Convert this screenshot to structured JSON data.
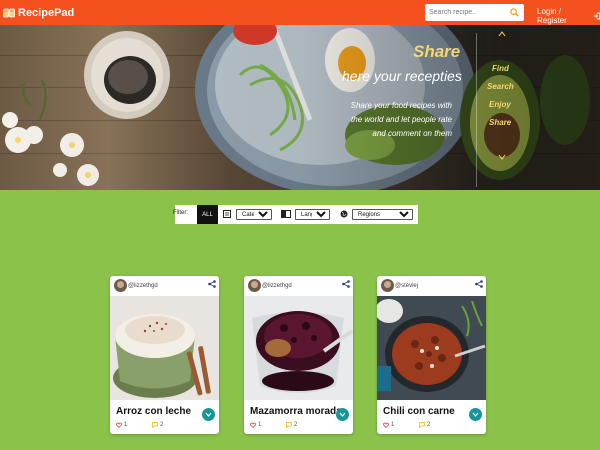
{
  "navbar": {
    "brand": "RecipePad",
    "search_placeholder": "Search recipe..",
    "login_label": "Login / Register"
  },
  "hero": {
    "title": "Share",
    "subtitle": "here your recepties",
    "description": "Share your food recipes with the world and let people rate and comment on them",
    "side_nav": [
      "Find",
      "Search",
      "Enjoy",
      "Share"
    ]
  },
  "filter": {
    "label": "Filter:",
    "all_label": "ALL",
    "categories": "Categories",
    "languages": "Languages",
    "regions": "Regions"
  },
  "recipes": [
    {
      "user": "@lizzethgd",
      "title": "Arroz con leche",
      "likes": "1",
      "comments": "2"
    },
    {
      "user": "@lizzethgd",
      "title": "Mazamorra morada",
      "likes": "1",
      "comments": "2"
    },
    {
      "user": "@steviej",
      "title": "Chili con carne",
      "likes": "1",
      "comments": "2"
    }
  ],
  "colors": {
    "navbar": "#f4511e",
    "background": "#8bc34a",
    "accent_yellow": "#f5d76e",
    "card_button": "#17969a",
    "like_icon": "#e53935",
    "comment_icon": "#f4b400"
  },
  "icons": {
    "brand": "book-icon",
    "search": "search-icon",
    "login": "sign-in-icon",
    "share": "share-icon",
    "expand": "chevron-down-icon",
    "like": "heart-icon",
    "comment": "comment-icon",
    "categories": "list-icon",
    "languages": "language-icon",
    "regions": "globe-icon"
  }
}
